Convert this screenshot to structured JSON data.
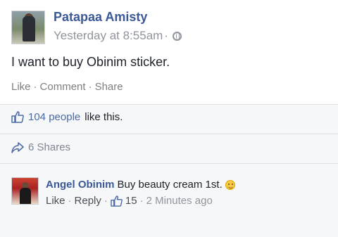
{
  "post": {
    "author": "Patapaa Amisty",
    "timestamp": "Yesterday at 8:55am",
    "privacy_separator": "·",
    "privacy_icon": "globe-icon",
    "text": "I want to buy Obinim sticker.",
    "actions": {
      "like": "Like",
      "comment": "Comment",
      "share": "Share",
      "separator": "·"
    }
  },
  "likes": {
    "count_text": "104 people",
    "suffix": "like this."
  },
  "shares": {
    "text": "6 Shares"
  },
  "comment": {
    "author": "Angel Obinim",
    "text": "Buy beauty cream 1st.",
    "emoji": "wink-smile-emoji",
    "actions": {
      "like": "Like",
      "reply": "Reply",
      "separator": "·",
      "like_count": "15",
      "time": "2 Minutes ago"
    }
  },
  "colors": {
    "link_blue": "#3b5998",
    "muted": "#90949c",
    "divider": "#dddfe2",
    "stripe_bg": "#f6f7f9"
  }
}
